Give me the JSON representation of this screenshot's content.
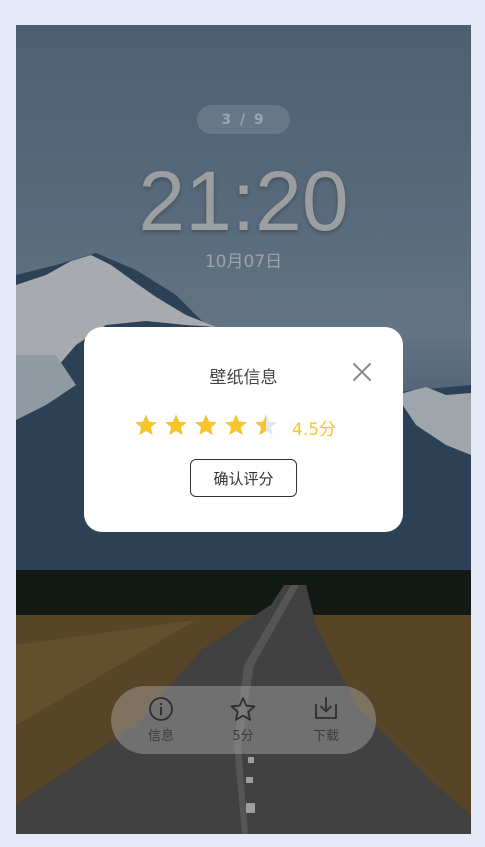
{
  "lockscreen": {
    "page_indicator": "3 / 9",
    "time": "21:20",
    "date": "10月07日"
  },
  "rating_modal": {
    "title": "壁纸信息",
    "rating": 4.5,
    "max_rating": 5,
    "score_label": "4.5分",
    "confirm_label": "确认评分"
  },
  "bottom_bar": {
    "items": [
      {
        "icon": "info-icon",
        "label": "信息"
      },
      {
        "icon": "star-outline-icon",
        "label": "5分"
      },
      {
        "icon": "download-icon",
        "label": "下载"
      }
    ]
  },
  "colors": {
    "star": "#f7c52a",
    "star_empty": "#e6e6e6",
    "page_bg": "#e3e9f5"
  }
}
